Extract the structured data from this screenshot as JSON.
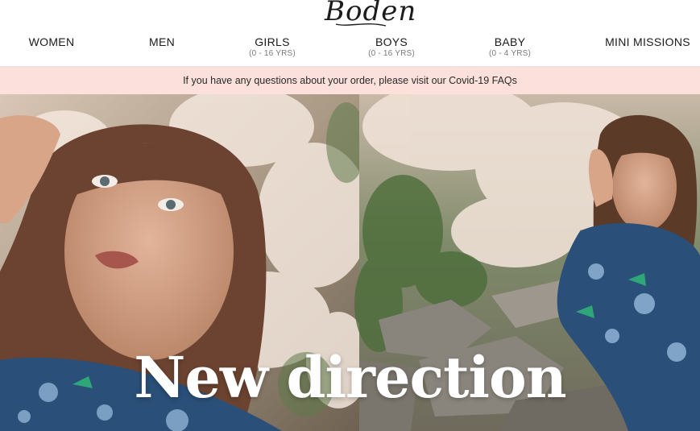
{
  "brand": {
    "logo_text": "Boden",
    "logo_icon": "boden-wordmark"
  },
  "nav": {
    "items": [
      {
        "label": "WOMEN",
        "sub": ""
      },
      {
        "label": "MEN",
        "sub": ""
      },
      {
        "label": "GIRLS",
        "sub": "(0 - 16 YRS)"
      },
      {
        "label": "BOYS",
        "sub": "(0 - 16 YRS)"
      },
      {
        "label": "BABY",
        "sub": "(0 - 4 YRS)"
      },
      {
        "label": "MINI MISSIONS",
        "sub": ""
      }
    ]
  },
  "banner": {
    "text": "If you have any questions about your order, please visit our Covid-19 FAQs",
    "background": "#fbe0dc"
  },
  "hero": {
    "title": "New direction",
    "left_image": "woman-with-pink-blossom-photo",
    "right_image": "woman-leaning-on-stone-wall-photo"
  }
}
